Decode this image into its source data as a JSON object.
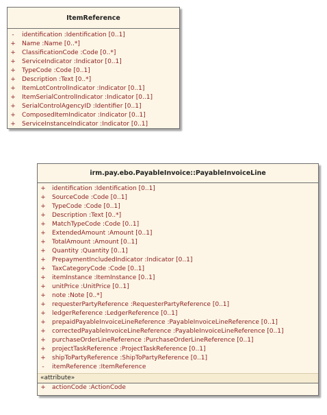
{
  "classes": [
    {
      "name": "ItemReference",
      "attributes": [
        {
          "vis": "-",
          "text": "identification  :Identification [0..1]"
        },
        {
          "vis": "+",
          "text": "Name  :Name [0..*]"
        },
        {
          "vis": "+",
          "text": "ClassificationCode  :Code [0..*]"
        },
        {
          "vis": "+",
          "text": "ServiceIndicator  :Indicator [0..1]"
        },
        {
          "vis": "+",
          "text": "TypeCode  :Code [0..1]"
        },
        {
          "vis": "+",
          "text": "Description  :Text [0..*]"
        },
        {
          "vis": "+",
          "text": "ItemLotControlIndicator  :Indicator [0..1]"
        },
        {
          "vis": "+",
          "text": "ItemSerialControlIndicator  :Indicator [0..1]"
        },
        {
          "vis": "+",
          "text": "SerialControlAgencyID  :Identifier [0..1]"
        },
        {
          "vis": "+",
          "text": "ComposedItemIndicator  :Indicator [0..1]"
        },
        {
          "vis": "+",
          "text": "ServiceInstanceIndicator  :Indicator [0..1]"
        }
      ]
    },
    {
      "name": "irm.pay.ebo.PayableInvoice::PayableInvoiceLine",
      "attributes": [
        {
          "vis": "+",
          "text": "identification  :Identification [0..1]"
        },
        {
          "vis": "+",
          "text": "SourceCode  :Code [0..1]"
        },
        {
          "vis": "+",
          "text": "TypeCode  :Code [0..1]"
        },
        {
          "vis": "+",
          "text": "Description  :Text [0..*]"
        },
        {
          "vis": "+",
          "text": "MatchTypeCode  :Code [0..1]"
        },
        {
          "vis": "+",
          "text": "ExtendedAmount  :Amount [0..1]"
        },
        {
          "vis": "+",
          "text": "TotalAmount  :Amount [0..1]"
        },
        {
          "vis": "+",
          "text": "Quantity  :Quantity [0..1]"
        },
        {
          "vis": "+",
          "text": "PrepaymentIncludedIndicator  :Indicator [0..1]"
        },
        {
          "vis": "+",
          "text": "TaxCategoryCode  :Code [0..1]"
        },
        {
          "vis": "+",
          "text": "itemInstance  :ItemInstance [0..1]"
        },
        {
          "vis": "+",
          "text": "unitPrice  :UnitPrice [0..1]"
        },
        {
          "vis": "+",
          "text": "note  :Note [0..*]"
        },
        {
          "vis": "+",
          "text": "requesterPartyReference  :RequesterPartyReference [0..1]"
        },
        {
          "vis": "+",
          "text": "ledgerReference  :LedgerReference [0..1]"
        },
        {
          "vis": "+",
          "text": "prepaidPayableInvoiceLineReference  :PayableInvoiceLineReference [0..1]"
        },
        {
          "vis": "+",
          "text": "correctedPayableInvoiceLineReference  :PayableInvoiceLineReference [0..1]"
        },
        {
          "vis": "+",
          "text": "purchaseOrderLineReference  :PurchaseOrderLineReference [0..1]"
        },
        {
          "vis": "+",
          "text": "projectTaskReference  :ProjectTaskReference [0..1]"
        },
        {
          "vis": "+",
          "text": "shipToPartyReference  :ShipToPartyReference [0..1]"
        },
        {
          "vis": "-",
          "text": "itemReference  :ItemReference"
        }
      ],
      "stereotype": "«attribute»",
      "operations": [
        {
          "vis": "+",
          "text": "actionCode  :ActionCode"
        }
      ]
    }
  ]
}
